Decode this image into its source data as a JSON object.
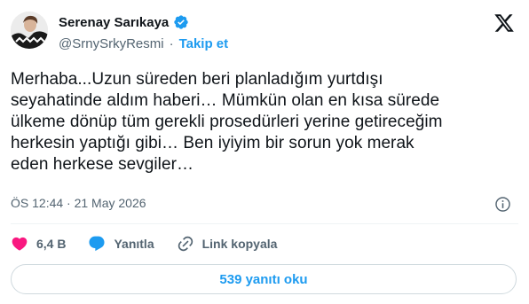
{
  "author": {
    "display_name": "Serenay Sarıkaya",
    "handle": "@SrnySrkyResmi",
    "separator": "·",
    "follow_label": "Takip et"
  },
  "tweet": {
    "text": "Merhaba...Uzun süreden beri planladığım yurtdışı\nseyahatinde aldım haberi… Mümkün olan en kısa sürede\nülkeme dönüp tüm gerekli prosedürleri yerine getireceğim\nherkesin yaptığı gibi… Ben iyiyim bir sorun yok merak\neden herkese sevgiler…",
    "timestamp": "ÖS 12:44 · 21 May 2026"
  },
  "actions": {
    "like_count": "6,4 B",
    "reply_label": "Yanıtla",
    "copy_link_label": "Link kopyala"
  },
  "replies_button": "539 yanıtı oku",
  "colors": {
    "accent": "#1d9bf0",
    "like": "#f91880",
    "text": "#0f1419",
    "muted": "#536471"
  },
  "icons": [
    "avatar-photo",
    "verified-badge-icon",
    "x-logo-icon",
    "info-icon",
    "heart-icon",
    "reply-bubble-icon",
    "link-icon"
  ]
}
